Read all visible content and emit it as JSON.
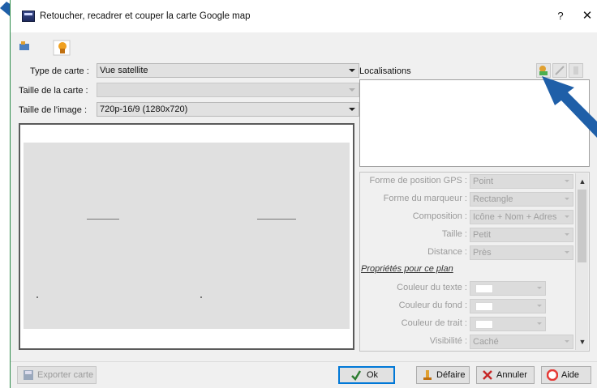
{
  "window": {
    "title": "Retoucher, recadrer et couper la carte Google map",
    "help_label": "?",
    "close_label": "✕"
  },
  "form": {
    "map_type": {
      "label": "Type de carte :",
      "value": "Vue satellite"
    },
    "map_size": {
      "label": "Taille de la carte :",
      "value": ""
    },
    "image_size": {
      "label": "Taille de l'image :",
      "value": "720p-16/9 (1280x720)"
    }
  },
  "locations": {
    "label": "Localisations"
  },
  "properties": {
    "gps_shape": {
      "label": "Forme de position GPS :",
      "value": "Point"
    },
    "marker_shape": {
      "label": "Forme du marqueur :",
      "value": "Rectangle"
    },
    "composition": {
      "label": "Composition :",
      "value": "Icône + Nom + Adres"
    },
    "size": {
      "label": "Taille :",
      "value": "Petit"
    },
    "distance": {
      "label": "Distance :",
      "value": "Près"
    },
    "section_title": "Propriétés pour ce plan",
    "text_color": {
      "label": "Couleur du texte :"
    },
    "bg_color": {
      "label": "Couleur du fond :"
    },
    "line_color": {
      "label": "Couleur de trait :"
    },
    "visibility": {
      "label": "Visibilité :",
      "value": "Caché"
    }
  },
  "buttons": {
    "export": "Exporter carte",
    "ok": "Ok",
    "undo": "Défaire",
    "cancel": "Annuler",
    "help": "Aide"
  },
  "colors": {
    "accent": "#0078d7",
    "annotation_arrow": "#1f5fa8",
    "window_border": "#2a8a47"
  }
}
